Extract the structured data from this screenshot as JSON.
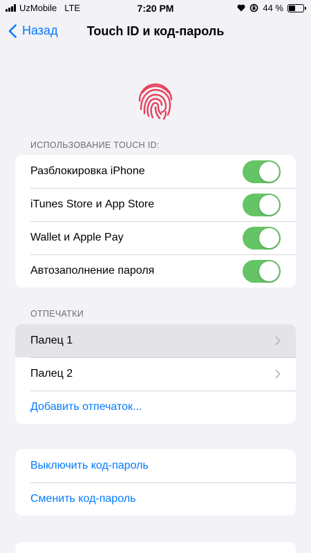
{
  "status_bar": {
    "carrier": "UzMobile",
    "network": "LTE",
    "time": "7:20 PM",
    "battery_percent": "44 %",
    "battery_level": 0.44
  },
  "nav": {
    "back_label": "Назад",
    "title": "Touch ID и код-пароль"
  },
  "touch_id_section": {
    "header": "ИСПОЛЬЗОВАНИЕ TOUCH ID:",
    "items": [
      {
        "label": "Разблокировка iPhone",
        "enabled": true
      },
      {
        "label": "iTunes Store и App Store",
        "enabled": true
      },
      {
        "label": "Wallet и Apple Pay",
        "enabled": true
      },
      {
        "label": "Автозаполнение пароля",
        "enabled": true
      }
    ]
  },
  "fingerprints_section": {
    "header": "ОТПЕЧАТКИ",
    "items": [
      {
        "label": "Палец 1"
      },
      {
        "label": "Палец 2"
      }
    ],
    "add_label": "Добавить отпечаток..."
  },
  "passcode_section": {
    "turn_off_label": "Выключить код-пароль",
    "change_label": "Сменить код-пароль"
  },
  "colors": {
    "accent": "#007aff",
    "toggle_on": "#65c466",
    "fingerprint": "#e8415a",
    "background": "#f2f2f7"
  }
}
